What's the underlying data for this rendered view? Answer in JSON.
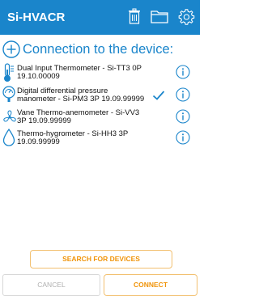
{
  "app": {
    "title": "Si-HVACR",
    "accent": "#1a85cb",
    "action_color": "#f0940a"
  },
  "toolbar": [
    {
      "icon": "trash-icon"
    },
    {
      "icon": "folder-icon"
    },
    {
      "icon": "gear-icon"
    }
  ],
  "connection": {
    "title": "Connection to the device:",
    "icon": "plus-circle-icon"
  },
  "devices": [
    {
      "icon": "thermometer-icon",
      "line1": "Dual Input Thermometer - Si-TT3 0P",
      "line2": "19.10.00009",
      "selected": false
    },
    {
      "icon": "pressure-gauge-icon",
      "line1": "Digital differential pressure",
      "line2": "manometer - Si-PM3 3P 19.09.99999",
      "selected": true
    },
    {
      "icon": "fan-icon",
      "line1": "Vane Thermo-anemometer - Si-VV3",
      "line2": "3P 19.09.99999",
      "selected": false
    },
    {
      "icon": "water-drop-icon",
      "line1": "Thermo-hygrometer - Si-HH3 3P",
      "line2": "19.09.99999",
      "selected": false
    }
  ],
  "buttons": {
    "search": "SEARCH FOR DEVICES",
    "cancel": "CANCEL",
    "connect": "CONNECT"
  }
}
